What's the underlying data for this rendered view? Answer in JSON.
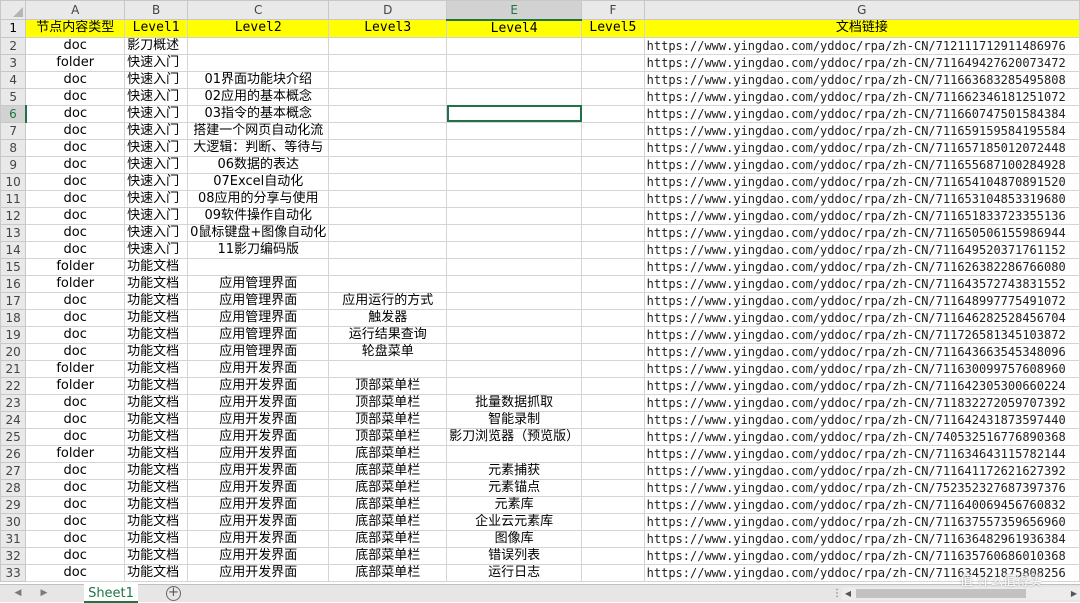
{
  "sheet": {
    "columns": [
      "A",
      "B",
      "C",
      "D",
      "E",
      "F",
      "G"
    ],
    "selected_column": "E",
    "selected_row": "6",
    "header_row": {
      "row_label": "1",
      "cells": [
        "节点内容类型",
        "Level1",
        "Level2",
        "Level3",
        "Level4",
        "Level5",
        "文档链接"
      ]
    },
    "rows": [
      {
        "n": "2",
        "a": "doc",
        "b": "影刀概述",
        "c": "",
        "d": "",
        "e": "",
        "f": "",
        "g": "https://www.yingdao.com/yddoc/rpa/zh-CN/712111712911486976"
      },
      {
        "n": "3",
        "a": "folder",
        "b": "快速入门",
        "c": "",
        "d": "",
        "e": "",
        "f": "",
        "g": "https://www.yingdao.com/yddoc/rpa/zh-CN/711649427620073472"
      },
      {
        "n": "4",
        "a": "doc",
        "b": "快速入门",
        "c": "01界面功能块介绍",
        "d": "",
        "e": "",
        "f": "",
        "g": "https://www.yingdao.com/yddoc/rpa/zh-CN/711663683285495808"
      },
      {
        "n": "5",
        "a": "doc",
        "b": "快速入门",
        "c": "02应用的基本概念",
        "d": "",
        "e": "",
        "f": "",
        "g": "https://www.yingdao.com/yddoc/rpa/zh-CN/711662346181251072"
      },
      {
        "n": "6",
        "a": "doc",
        "b": "快速入门",
        "c": "03指令的基本概念",
        "d": "",
        "e": "",
        "f": "",
        "g": "https://www.yingdao.com/yddoc/rpa/zh-CN/711660747501584384"
      },
      {
        "n": "7",
        "a": "doc",
        "b": "快速入门",
        "c": "搭建一个网页自动化流",
        "d": "",
        "e": "",
        "f": "",
        "g": "https://www.yingdao.com/yddoc/rpa/zh-CN/711659159584195584"
      },
      {
        "n": "8",
        "a": "doc",
        "b": "快速入门",
        "c": "大逻辑：判断、等待与",
        "d": "",
        "e": "",
        "f": "",
        "g": "https://www.yingdao.com/yddoc/rpa/zh-CN/711657185012072448"
      },
      {
        "n": "9",
        "a": "doc",
        "b": "快速入门",
        "c": "06数据的表达",
        "d": "",
        "e": "",
        "f": "",
        "g": "https://www.yingdao.com/yddoc/rpa/zh-CN/711655687100284928"
      },
      {
        "n": "10",
        "a": "doc",
        "b": "快速入门",
        "c": "07Excel自动化",
        "d": "",
        "e": "",
        "f": "",
        "g": "https://www.yingdao.com/yddoc/rpa/zh-CN/711654104870891520"
      },
      {
        "n": "11",
        "a": "doc",
        "b": "快速入门",
        "c": "08应用的分享与使用",
        "d": "",
        "e": "",
        "f": "",
        "g": "https://www.yingdao.com/yddoc/rpa/zh-CN/711653104853319680"
      },
      {
        "n": "12",
        "a": "doc",
        "b": "快速入门",
        "c": "09软件操作自动化",
        "d": "",
        "e": "",
        "f": "",
        "g": "https://www.yingdao.com/yddoc/rpa/zh-CN/711651833723355136"
      },
      {
        "n": "13",
        "a": "doc",
        "b": "快速入门",
        "c": "0鼠标键盘+图像自动化",
        "d": "",
        "e": "",
        "f": "",
        "g": "https://www.yingdao.com/yddoc/rpa/zh-CN/711650506155986944"
      },
      {
        "n": "14",
        "a": "doc",
        "b": "快速入门",
        "c": "11影刀编码版",
        "d": "",
        "e": "",
        "f": "",
        "g": "https://www.yingdao.com/yddoc/rpa/zh-CN/711649520371761152"
      },
      {
        "n": "15",
        "a": "folder",
        "b": "功能文档",
        "c": "",
        "d": "",
        "e": "",
        "f": "",
        "g": "https://www.yingdao.com/yddoc/rpa/zh-CN/711626382286766080"
      },
      {
        "n": "16",
        "a": "folder",
        "b": "功能文档",
        "c": "应用管理界面",
        "d": "",
        "e": "",
        "f": "",
        "g": "https://www.yingdao.com/yddoc/rpa/zh-CN/711643572743831552"
      },
      {
        "n": "17",
        "a": "doc",
        "b": "功能文档",
        "c": "应用管理界面",
        "d": "应用运行的方式",
        "e": "",
        "f": "",
        "g": "https://www.yingdao.com/yddoc/rpa/zh-CN/711648997775491072"
      },
      {
        "n": "18",
        "a": "doc",
        "b": "功能文档",
        "c": "应用管理界面",
        "d": "触发器",
        "e": "",
        "f": "",
        "g": "https://www.yingdao.com/yddoc/rpa/zh-CN/711646282528456704"
      },
      {
        "n": "19",
        "a": "doc",
        "b": "功能文档",
        "c": "应用管理界面",
        "d": "运行结果查询",
        "e": "",
        "f": "",
        "g": "https://www.yingdao.com/yddoc/rpa/zh-CN/711726581345103872"
      },
      {
        "n": "20",
        "a": "doc",
        "b": "功能文档",
        "c": "应用管理界面",
        "d": "轮盘菜单",
        "e": "",
        "f": "",
        "g": "https://www.yingdao.com/yddoc/rpa/zh-CN/711643663545348096"
      },
      {
        "n": "21",
        "a": "folder",
        "b": "功能文档",
        "c": "应用开发界面",
        "d": "",
        "e": "",
        "f": "",
        "g": "https://www.yingdao.com/yddoc/rpa/zh-CN/711630099757608960"
      },
      {
        "n": "22",
        "a": "folder",
        "b": "功能文档",
        "c": "应用开发界面",
        "d": "顶部菜单栏",
        "e": "",
        "f": "",
        "g": "https://www.yingdao.com/yddoc/rpa/zh-CN/711642305300660224"
      },
      {
        "n": "23",
        "a": "doc",
        "b": "功能文档",
        "c": "应用开发界面",
        "d": "顶部菜单栏",
        "e": "批量数据抓取",
        "f": "",
        "g": "https://www.yingdao.com/yddoc/rpa/zh-CN/711832272059707392"
      },
      {
        "n": "24",
        "a": "doc",
        "b": "功能文档",
        "c": "应用开发界面",
        "d": "顶部菜单栏",
        "e": "智能录制",
        "f": "",
        "g": "https://www.yingdao.com/yddoc/rpa/zh-CN/711642431873597440"
      },
      {
        "n": "25",
        "a": "doc",
        "b": "功能文档",
        "c": "应用开发界面",
        "d": "顶部菜单栏",
        "e": "影刀浏览器（预览版）",
        "f": "",
        "g": "https://www.yingdao.com/yddoc/rpa/zh-CN/740532516776890368"
      },
      {
        "n": "26",
        "a": "folder",
        "b": "功能文档",
        "c": "应用开发界面",
        "d": "底部菜单栏",
        "e": "",
        "f": "",
        "g": "https://www.yingdao.com/yddoc/rpa/zh-CN/711634643115782144"
      },
      {
        "n": "27",
        "a": "doc",
        "b": "功能文档",
        "c": "应用开发界面",
        "d": "底部菜单栏",
        "e": "元素捕获",
        "f": "",
        "g": "https://www.yingdao.com/yddoc/rpa/zh-CN/711641172621627392"
      },
      {
        "n": "28",
        "a": "doc",
        "b": "功能文档",
        "c": "应用开发界面",
        "d": "底部菜单栏",
        "e": "元素锚点",
        "f": "",
        "g": "https://www.yingdao.com/yddoc/rpa/zh-CN/752352327687397376"
      },
      {
        "n": "29",
        "a": "doc",
        "b": "功能文档",
        "c": "应用开发界面",
        "d": "底部菜单栏",
        "e": "元素库",
        "f": "",
        "g": "https://www.yingdao.com/yddoc/rpa/zh-CN/711640069456760832"
      },
      {
        "n": "30",
        "a": "doc",
        "b": "功能文档",
        "c": "应用开发界面",
        "d": "底部菜单栏",
        "e": "企业云元素库",
        "f": "",
        "g": "https://www.yingdao.com/yddoc/rpa/zh-CN/711637557359656960"
      },
      {
        "n": "31",
        "a": "doc",
        "b": "功能文档",
        "c": "应用开发界面",
        "d": "底部菜单栏",
        "e": "图像库",
        "f": "",
        "g": "https://www.yingdao.com/yddoc/rpa/zh-CN/711636482961936384"
      },
      {
        "n": "32",
        "a": "doc",
        "b": "功能文档",
        "c": "应用开发界面",
        "d": "底部菜单栏",
        "e": "错误列表",
        "f": "",
        "g": "https://www.yingdao.com/yddoc/rpa/zh-CN/711635760686010368"
      },
      {
        "n": "33",
        "a": "doc",
        "b": "功能文档",
        "c": "应用开发界面",
        "d": "底部菜单栏",
        "e": "运行日志",
        "f": "",
        "g": "https://www.yingdao.com/yddoc/rpa/zh-CN/711634521875808256"
      }
    ]
  },
  "tabs": {
    "prev_icon": "◀",
    "next_icon": "▶",
    "sheet_name": "Sheet1",
    "add_icon": "+",
    "split_icon": "⋮"
  },
  "scrollbar": {
    "left_icon": "◀",
    "right_icon": "▶"
  },
  "watermark": "值 什么值得买"
}
